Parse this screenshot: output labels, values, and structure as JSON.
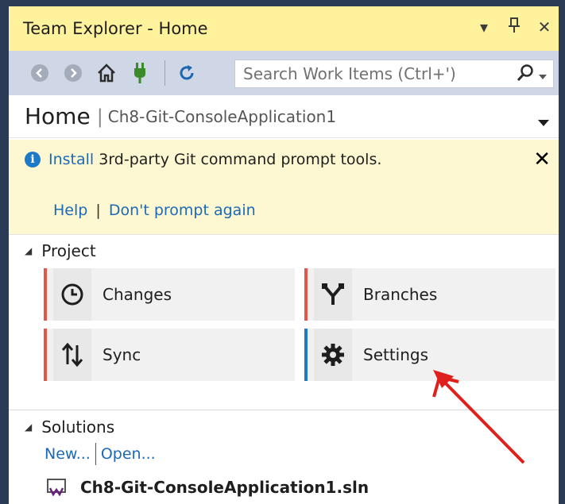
{
  "window": {
    "title": "Team Explorer - Home",
    "controls": {
      "dropdown": "▾",
      "pin": "⊥",
      "close": "✕"
    }
  },
  "toolbar": {
    "search_placeholder": "Search Work Items (Ctrl+')"
  },
  "header": {
    "title": "Home",
    "separator": "|",
    "subtitle": "Ch8-Git-ConsoleApplication1"
  },
  "notice": {
    "link": "Install",
    "text": " 3rd-party Git command prompt tools.",
    "help": "Help",
    "sep": "|",
    "dont_prompt": "Don't prompt again"
  },
  "project": {
    "title": "Project",
    "tiles": [
      {
        "label": "Changes",
        "icon": "clock-icon"
      },
      {
        "label": "Branches",
        "icon": "branch-icon"
      },
      {
        "label": "Sync",
        "icon": "sync-arrows-icon"
      },
      {
        "label": "Settings",
        "icon": "gear-icon"
      }
    ]
  },
  "solutions": {
    "title": "Solutions",
    "new_link": "New...",
    "open_link": "Open...",
    "file": "Ch8-Git-ConsoleApplication1.sln"
  },
  "colors": {
    "title_bg": "#fff29d",
    "toolbar_bg": "#cfd6e5",
    "notice_bg": "#fdf8d1",
    "link": "#1b6ab8",
    "accent_red": "#e2574a",
    "accent_blue": "#1f78c8",
    "annotation_arrow": "#e0201c"
  }
}
